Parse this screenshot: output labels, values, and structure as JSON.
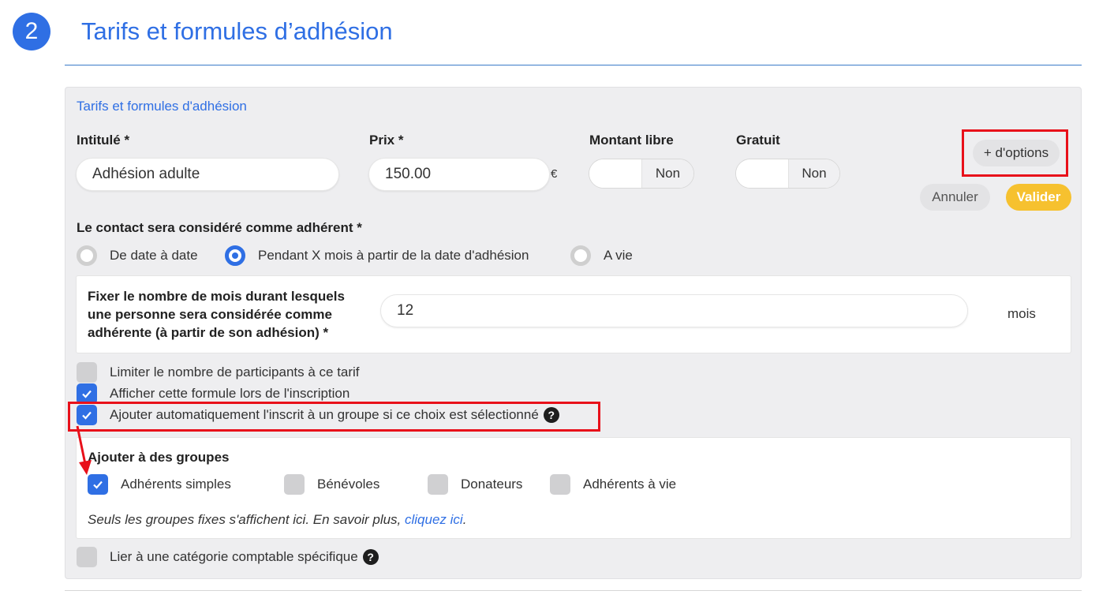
{
  "header": {
    "step_number": "2",
    "title": "Tarifs et formules d’adhésion"
  },
  "panel": {
    "heading": "Tarifs et formules d'adhésion",
    "fields": {
      "intitule": {
        "label": "Intitulé *",
        "value": "Adhésion adulte"
      },
      "prix": {
        "label": "Prix *",
        "value": "150.00",
        "currency": "€"
      },
      "montant_libre": {
        "label": "Montant libre",
        "state": "Non"
      },
      "gratuit": {
        "label": "Gratuit",
        "state": "Non"
      }
    },
    "buttons": {
      "options": "+ d'options",
      "cancel": "Annuler",
      "validate": "Valider"
    },
    "membership": {
      "label": "Le contact sera considéré comme adhérent *",
      "options": [
        {
          "label": "De date à date",
          "selected": false
        },
        {
          "label": "Pendant X mois à partir de la date d'adhésion",
          "selected": true
        },
        {
          "label": "A vie",
          "selected": false
        }
      ]
    },
    "months": {
      "label": "Fixer le nombre de mois durant lesquels une personne sera considérée comme adhérente (à partir de son adhésion) *",
      "value": "12",
      "unit": "mois"
    },
    "checkboxes": [
      {
        "label": "Limiter le nombre de participants à ce tarif",
        "checked": false
      },
      {
        "label": "Afficher cette formule lors de l'inscription",
        "checked": true
      },
      {
        "label": "Ajouter automatiquement l'inscrit à un groupe si ce choix est sélectionné",
        "checked": true
      }
    ],
    "groups": {
      "label": "Ajouter à des groupes",
      "items": [
        {
          "label": "Adhérents simples",
          "checked": true
        },
        {
          "label": "Bénévoles",
          "checked": false
        },
        {
          "label": "Donateurs",
          "checked": false
        },
        {
          "label": "Adhérents à vie",
          "checked": false
        }
      ],
      "note": "Seuls les groupes fixes s'affichent ici. En savoir plus, ",
      "note_link": "cliquez ici",
      "note_end": "."
    },
    "accounting": {
      "label": "Lier à une catégorie comptable spécifique",
      "checked": false
    },
    "help_glyph": "?"
  },
  "colors": {
    "primary": "#2f6fe4",
    "accent_yellow": "#f6c12f",
    "highlight_red": "#e8101a",
    "panel_bg": "#eeeef0"
  }
}
